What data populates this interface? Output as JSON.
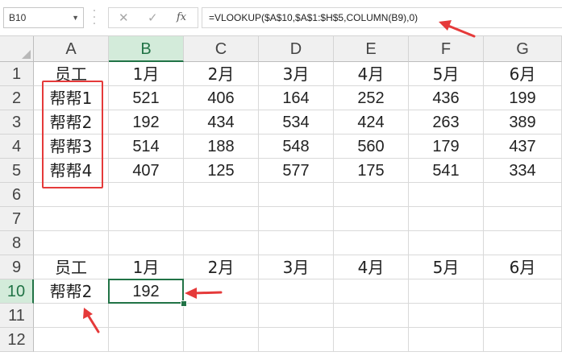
{
  "formula_bar": {
    "name_box": "B10",
    "cancel_glyph": "✕",
    "enter_glyph": "✓",
    "function_glyph": "fx",
    "formula": "=VLOOKUP($A$10,$A$1:$H$5,COLUMN(B9),0)"
  },
  "sheet": {
    "columns": [
      "A",
      "B",
      "C",
      "D",
      "E",
      "F",
      "G"
    ],
    "selected_column": "B",
    "selected_row": "10",
    "active_cell": "B10",
    "rows": [
      {
        "num": "1",
        "cells": [
          "员工",
          "1月",
          "2月",
          "3月",
          "4月",
          "5月",
          "6月"
        ]
      },
      {
        "num": "2",
        "cells": [
          "帮帮1",
          "521",
          "406",
          "164",
          "252",
          "436",
          "199"
        ]
      },
      {
        "num": "3",
        "cells": [
          "帮帮2",
          "192",
          "434",
          "534",
          "424",
          "263",
          "389"
        ]
      },
      {
        "num": "4",
        "cells": [
          "帮帮3",
          "514",
          "188",
          "548",
          "560",
          "179",
          "437"
        ]
      },
      {
        "num": "5",
        "cells": [
          "帮帮4",
          "407",
          "125",
          "577",
          "175",
          "541",
          "334"
        ]
      },
      {
        "num": "6",
        "cells": [
          "",
          "",
          "",
          "",
          "",
          "",
          ""
        ]
      },
      {
        "num": "7",
        "cells": [
          "",
          "",
          "",
          "",
          "",
          "",
          ""
        ]
      },
      {
        "num": "8",
        "cells": [
          "",
          "",
          "",
          "",
          "",
          "",
          ""
        ]
      },
      {
        "num": "9",
        "cells": [
          "员工",
          "1月",
          "2月",
          "3月",
          "4月",
          "5月",
          "6月"
        ]
      },
      {
        "num": "10",
        "cells": [
          "帮帮2",
          "192",
          "",
          "",
          "",
          "",
          ""
        ]
      },
      {
        "num": "11",
        "cells": [
          "",
          "",
          "",
          "",
          "",
          "",
          ""
        ]
      },
      {
        "num": "12",
        "cells": [
          "",
          "",
          "",
          "",
          "",
          "",
          ""
        ]
      }
    ]
  },
  "annotation_color": "#e53a3a",
  "accent_color": "#217346"
}
